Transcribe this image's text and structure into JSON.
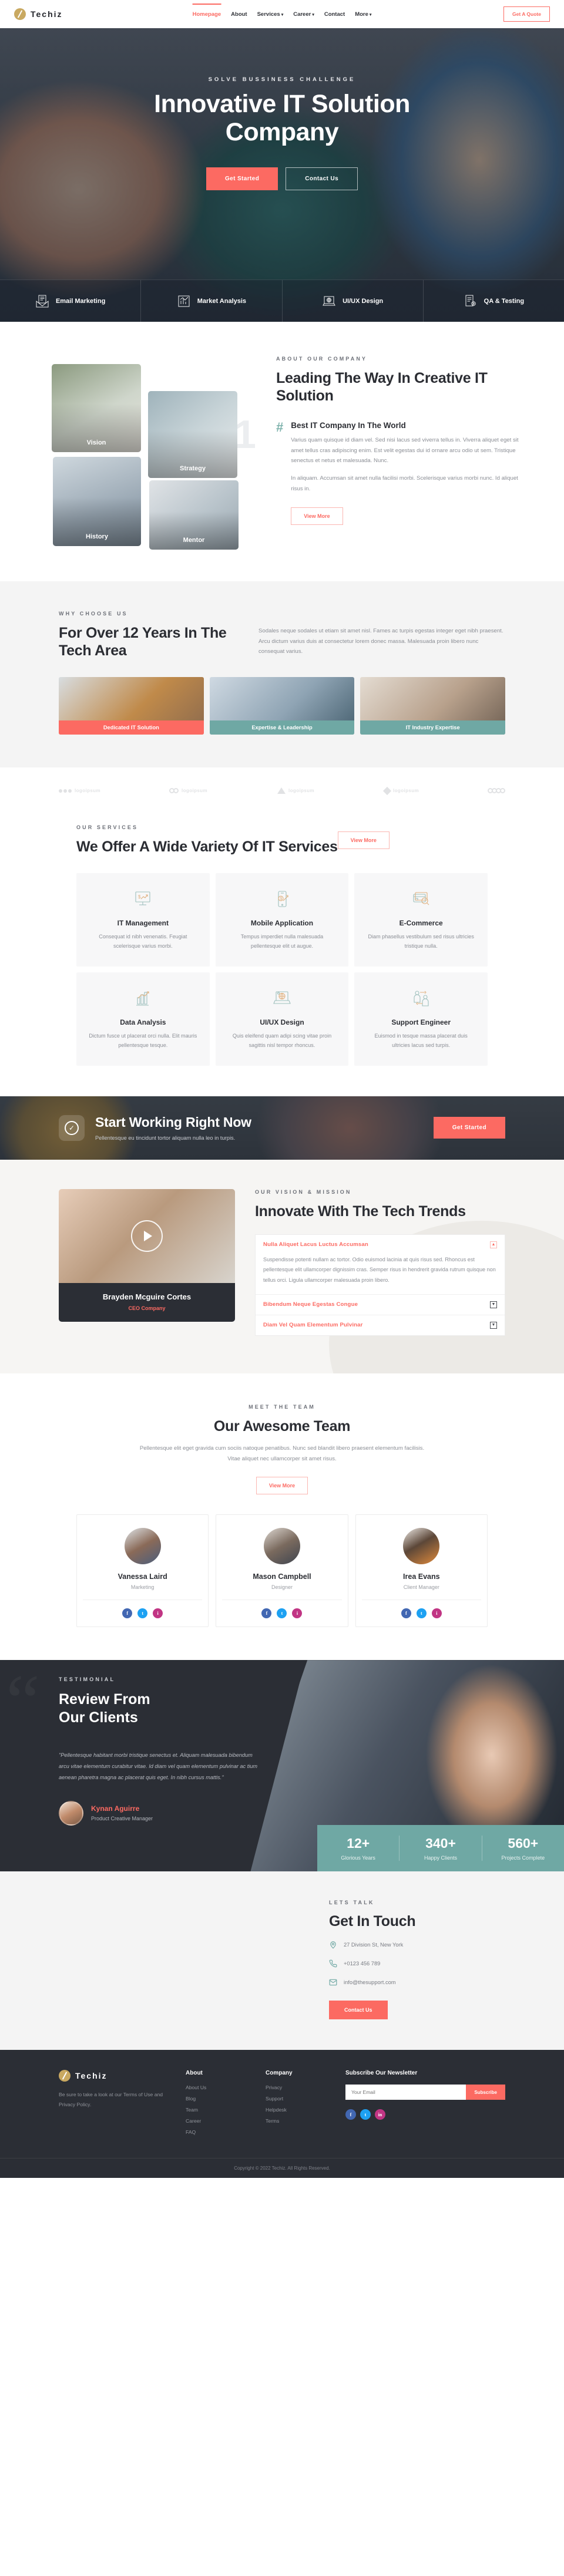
{
  "header": {
    "brand": "Techiz",
    "nav": [
      {
        "label": "Homepage",
        "active": true,
        "caret": false
      },
      {
        "label": "About",
        "active": false,
        "caret": false
      },
      {
        "label": "Services",
        "active": false,
        "caret": true
      },
      {
        "label": "Career",
        "active": false,
        "caret": true
      },
      {
        "label": "Contact",
        "active": false,
        "caret": false
      },
      {
        "label": "More",
        "active": false,
        "caret": true
      }
    ],
    "quote_button": "Get A Quote"
  },
  "hero": {
    "kicker": "SOLVE BUSSINESS CHALLENGE",
    "title_line1": "Innovative IT Solution",
    "title_line2": "Company",
    "primary_button": "Get Started",
    "secondary_button": "Contact Us",
    "features": [
      {
        "label": "Email Marketing",
        "icon": "envelope-document-icon"
      },
      {
        "label": "Market Analysis",
        "icon": "bar-chart-icon"
      },
      {
        "label": "UI/UX Design",
        "icon": "laptop-globe-icon"
      },
      {
        "label": "QA & Testing",
        "icon": "document-gear-icon"
      }
    ]
  },
  "about": {
    "kicker": "ABOUT OUR COMPANY",
    "heading": "Leading The Way In Creative IT Solution",
    "big_number": "1",
    "images": [
      {
        "label": "Vision"
      },
      {
        "label": "Strategy"
      },
      {
        "label": "History"
      },
      {
        "label": "Mentor"
      }
    ],
    "feature_title": "Best IT Company In The World",
    "paragraph1": "Varius quam quisque id diam vel. Sed nisi lacus sed viverra tellus in. Viverra aliquet eget sit amet tellus cras adipiscing enim. Est velit egestas dui id ornare arcu odio ut sem. Tristique senectus et netus et malesuada. Nunc.",
    "paragraph2": "In aliquam. Accumsan sit amet nulla facilisi morbi. Scelerisque varius morbi nunc. Id aliquet risus in.",
    "button": "View More"
  },
  "why": {
    "kicker": "WHY CHOOSE US",
    "heading": "For Over 12 Years In The Tech Area",
    "paragraph": "Sodales neque sodales ut etiam sit amet nisl. Fames ac turpis egestas integer eget nibh praesent. Arcu dictum varius duis at consectetur lorem donec massa. Malesuada proin libero nunc consequat varius.",
    "cards": [
      {
        "label": "Dedicated IT Solution"
      },
      {
        "label": "Expertise & Leadership"
      },
      {
        "label": "IT Industry Expertise"
      }
    ]
  },
  "clients": {
    "logos": [
      {
        "text": "logoipsum",
        "shape": "dots"
      },
      {
        "text": "logoipsum",
        "shape": "rings"
      },
      {
        "text": "logoipsum",
        "shape": "triangle"
      },
      {
        "text": "logoipsum",
        "shape": "square"
      },
      {
        "text": "",
        "shape": "circles"
      }
    ]
  },
  "services": {
    "kicker": "OUR SERVICES",
    "heading": "We Offer A Wide Variety Of IT Services",
    "button": "View More",
    "items": [
      {
        "title": "IT Management",
        "desc": "Consequat id nibh venenatis. Feugiat scelerisque varius morbi.",
        "icon": "monitor-growth-icon"
      },
      {
        "title": "Mobile Application",
        "desc": "Tempus imperdiet nulla malesuada pellentesque elit ut augue.",
        "icon": "mobile-payment-icon"
      },
      {
        "title": "E-Commerce",
        "desc": "Diam phasellus vestibulum sed risus ultricies tristique nulla.",
        "icon": "credit-card-search-icon"
      },
      {
        "title": "Data Analysis",
        "desc": "Dictum fusce ut placerat orci nulla. Elit mauris pellentesque tesque.",
        "icon": "bar-chart-arrow-icon"
      },
      {
        "title": "UI/UX Design",
        "desc": "Quis eleifend quam adipi scing vitae proin sagittis nisl tempor rhoncus.",
        "icon": "laptop-globe-icon"
      },
      {
        "title": "Support Engineer",
        "desc": "Euismod in tesque massa placerat duis ultricies lacus sed turpis.",
        "icon": "two-people-exchange-icon"
      }
    ]
  },
  "cta": {
    "title": "Start Working Right Now",
    "subtitle": "Pellentesque eu tincidunt tortor aliquam nulla leo in turpis.",
    "button": "Get Started",
    "icon": "check-circle-icon"
  },
  "vision": {
    "kicker": "OUR VISION & MISSION",
    "heading": "Innovate With The Tech Trends",
    "video": {
      "name": "Brayden Mcguire Cortes",
      "role": "CEO Company",
      "play_icon": "play-circle-icon"
    },
    "accordion": [
      {
        "title": "Nulla Aliquet Lacus Luctus Accumsan",
        "open": true,
        "sign": "▲",
        "body": "Suspendisse potenti nullam ac tortor. Odio euismod lacinia at quis risus sed. Rhoncus est pellentesque elit ullamcorper dignissim cras. Semper risus in hendrerit gravida rutrum quisque non tellus orci. Ligula ullamcorper malesuada proin libero."
      },
      {
        "title": "Bibendum Neque Egestas Congue",
        "open": false,
        "sign": "▼",
        "body": ""
      },
      {
        "title": "Diam Vel Quam Elementum Pulvinar",
        "open": false,
        "sign": "▼",
        "body": ""
      }
    ]
  },
  "team": {
    "kicker": "MEET THE TEAM",
    "heading": "Our Awesome Team",
    "paragraph": "Pellentesque elit eget gravida cum sociis natoque penatibus. Nunc sed blandit libero praesent elementum facilisis. Vitae aliquet nec ullamcorper sit amet risus.",
    "button": "View More",
    "members": [
      {
        "name": "Vanessa Laird",
        "role": "Marketing"
      },
      {
        "name": "Mason Campbell",
        "role": "Designer"
      },
      {
        "name": "Irea Evans",
        "role": "Client Manager"
      }
    ],
    "social": [
      "f",
      "t",
      "i"
    ]
  },
  "testimonial": {
    "kicker": "TESTIMONIAL",
    "heading_line1": "Review From",
    "heading_line2": "Our Clients",
    "quote": "\"Pellentesque habitant morbi tristique senectus et. Aliquam malesuada bibendum arcu vitae elementum curabitur vitae. Id diam vel quam elementum pulvinar ac tium aenean pharetra magna ac placerat quis eget. In nibh cursus mattis.\"",
    "author_name": "Kynan Aguirre",
    "author_role": "Product Creative Manager",
    "stats": [
      {
        "number": "12+",
        "label": "Glorious Years"
      },
      {
        "number": "340+",
        "label": "Happy Clients"
      },
      {
        "number": "560+",
        "label": "Projects Complete"
      }
    ]
  },
  "contact": {
    "kicker": "LETS TALK",
    "heading": "Get In Touch",
    "items": [
      {
        "icon": "location-pin-icon",
        "text": "27 Division St, New York"
      },
      {
        "icon": "phone-icon",
        "text": "+0123 456 789"
      },
      {
        "icon": "envelope-icon",
        "text": "info@thesupport.com"
      }
    ],
    "button": "Contact Us"
  },
  "footer": {
    "brand": "Techiz",
    "about": "Be sure to take a look at our Terms of Use and Privacy Policy.",
    "columns": [
      {
        "title": "About",
        "links": [
          "About Us",
          "Blog",
          "Team",
          "Career",
          "FAQ"
        ]
      },
      {
        "title": "Company",
        "links": [
          "Privacy",
          "Support",
          "Helpdesk",
          "Terms"
        ]
      }
    ],
    "newsletter_title": "Subscribe Our Newsletter",
    "newsletter_placeholder": "Your Email",
    "newsletter_button": "Subscribe",
    "social": [
      "f",
      "t",
      "in"
    ],
    "copyright": "Copyright © 2022 Techiz. All Rights Reserved."
  }
}
